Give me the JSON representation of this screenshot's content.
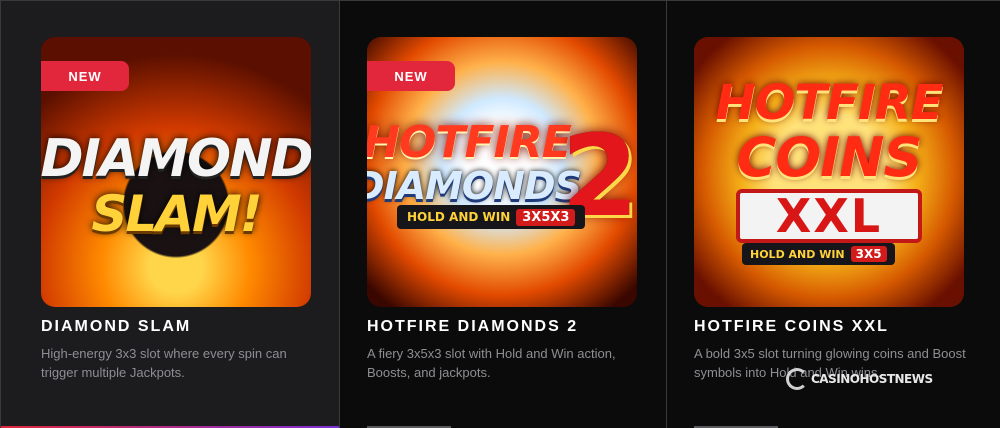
{
  "games": [
    {
      "badge": "NEW",
      "logo": {
        "line1": "DIAMOND",
        "line2": "SLAM!"
      },
      "title": "DIAMOND SLAM",
      "description": "High-energy 3x3 slot where every spin can trigger multiple Jackpots."
    },
    {
      "badge": "NEW",
      "logo": {
        "line1": "HOTFIRE",
        "line2": "DIAMONDS",
        "number": "2",
        "strip_text": "HOLD AND WIN",
        "strip_pill": "3X5X3"
      },
      "title": "HOTFIRE DIAMONDS 2",
      "description": "A fiery 3x5x3 slot with Hold and Win action, Boosts, and jackpots."
    },
    {
      "logo": {
        "line1": "HOTFIRE",
        "line2": "COINS",
        "box": "XXL",
        "strip_text": "HOLD AND WIN",
        "strip_pill": "3X5"
      },
      "title": "HOTFIRE COINS XXL",
      "description": "A bold 3x5 slot turning glowing coins and Boost symbols into Hold and Win wins."
    }
  ],
  "watermark": "CASINOHOSTNEWS"
}
